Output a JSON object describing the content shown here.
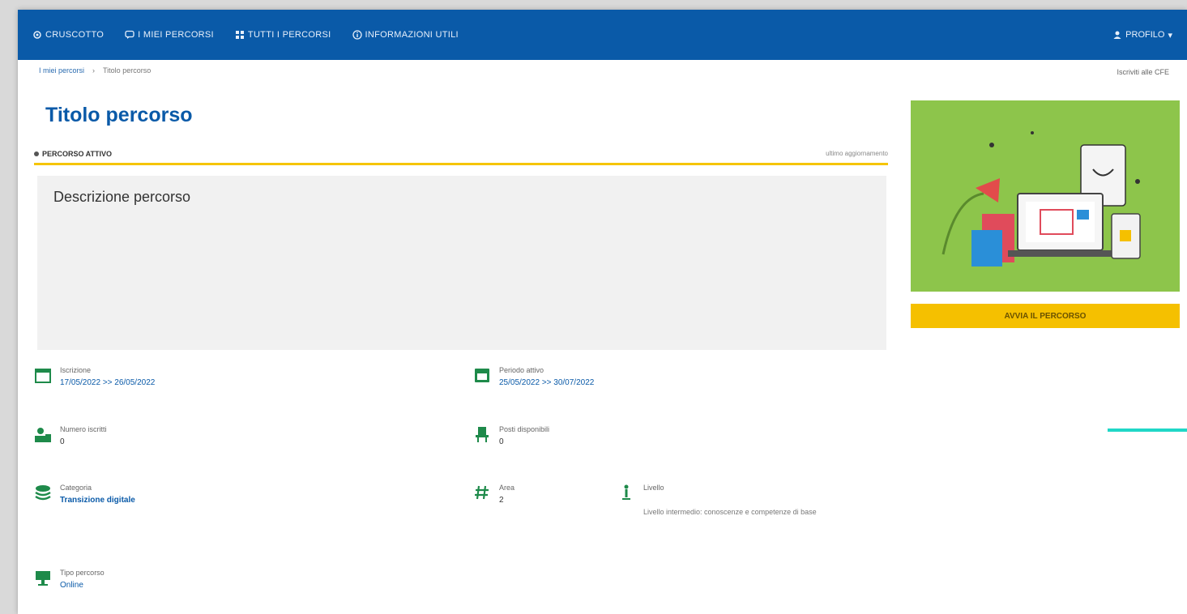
{
  "nav": {
    "items": [
      {
        "label": "Cruscotto",
        "icon": "gear-icon"
      },
      {
        "label": "I miei percorsi",
        "icon": "chat-icon"
      },
      {
        "label": "Tutti i percorsi",
        "icon": "grid-icon"
      },
      {
        "label": "Informazioni utili",
        "icon": "info-icon"
      }
    ],
    "profile": {
      "label": "Profilo",
      "icon": "user-icon",
      "caret": "▾"
    }
  },
  "breadcrumb": {
    "parent": "I miei percorsi",
    "separator": "›",
    "current": "Titolo percorso"
  },
  "top_right_link": "Iscriviti alle CFE",
  "page_title": "Titolo percorso",
  "status": {
    "label": "Percorso attivo",
    "right_text": "ultimo aggiornamento"
  },
  "description": {
    "title": "Descrizione percorso"
  },
  "cta": {
    "label": "Avvia il percorso"
  },
  "info": {
    "iscrizione": {
      "label": "Iscrizione",
      "value": "17/05/2022 >> 26/05/2022",
      "icon": "calendar-icon"
    },
    "periodo": {
      "label": "Periodo attivo",
      "value": "25/05/2022 >> 30/07/2022",
      "icon": "calendar-filled-icon"
    },
    "numero": {
      "label": "Numero iscritti",
      "value": "0",
      "icon": "users-icon"
    },
    "posti": {
      "label": "Posti disponibili",
      "value": "0",
      "icon": "chair-icon"
    },
    "categoria": {
      "label": "Categoria",
      "value": "Transizione digitale",
      "icon": "layers-icon"
    },
    "area": {
      "label": "Area",
      "value": "2",
      "icon": "hashtag-icon"
    },
    "livello": {
      "label": "Livello",
      "value": "Livello intermedio: conoscenze e competenze di base",
      "icon": "level-icon"
    },
    "tipo": {
      "label": "Tipo percorso",
      "value": "Online",
      "icon": "monitor-icon"
    }
  },
  "colors": {
    "nav": "#0a5aa8",
    "accent": "#f5c500",
    "icon": "#1e8a4a",
    "hero_bg": "#8dc54b",
    "teal": "#20d7c7"
  }
}
